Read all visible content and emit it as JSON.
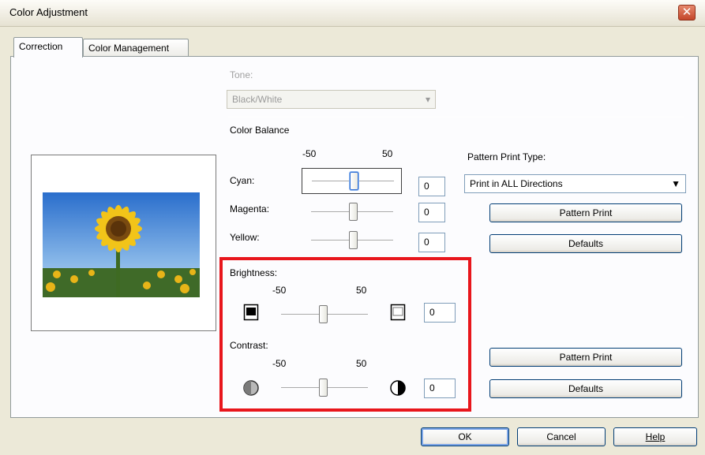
{
  "window": {
    "title": "Color Adjustment",
    "close_label": "✕"
  },
  "tabs": [
    {
      "label": "Correction",
      "active": true
    },
    {
      "label": "Color Management",
      "active": false
    }
  ],
  "tone": {
    "label": "Tone:",
    "value": "Black/White"
  },
  "color_balance": {
    "heading": "Color Balance",
    "scale_min": "-50",
    "scale_max": "50",
    "cyan": {
      "label": "Cyan:",
      "value": "0"
    },
    "magenta": {
      "label": "Magenta:",
      "value": "0"
    },
    "yellow": {
      "label": "Yellow:",
      "value": "0"
    }
  },
  "pattern": {
    "type_label": "Pattern Print Type:",
    "type_value": "Print in ALL Directions",
    "print_button": "Pattern Print",
    "defaults_button": "Defaults"
  },
  "brightness": {
    "label": "Brightness:",
    "scale_min": "-50",
    "scale_max": "50",
    "value": "0"
  },
  "contrast": {
    "label": "Contrast:",
    "scale_min": "-50",
    "scale_max": "50",
    "value": "0"
  },
  "lower_buttons": {
    "pattern_print": "Pattern Print",
    "defaults": "Defaults"
  },
  "footer": {
    "ok": "OK",
    "cancel": "Cancel",
    "help": "Help"
  },
  "colors": {
    "highlight": "#e8161c",
    "default_button_focus": "#7ca5e6"
  }
}
